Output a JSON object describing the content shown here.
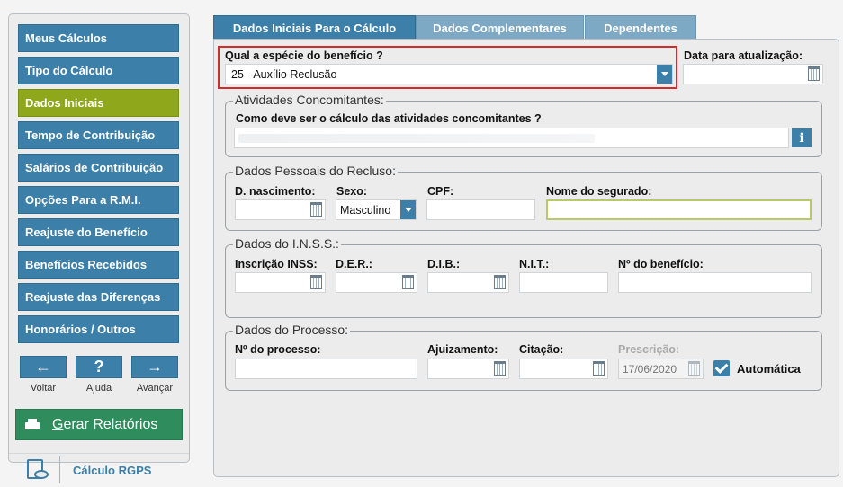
{
  "sidebar": {
    "items": [
      {
        "label": "Meus Cálculos"
      },
      {
        "label": "Tipo do Cálculo"
      },
      {
        "label": "Dados Iniciais"
      },
      {
        "label": "Tempo de Contribuição"
      },
      {
        "label": "Salários de Contribuição"
      },
      {
        "label": "Opções Para a R.M.I."
      },
      {
        "label": "Reajuste do Benefício"
      },
      {
        "label": "Benefícios Recebidos"
      },
      {
        "label": "Reajuste das Diferenças"
      },
      {
        "label": "Honorários / Outros"
      }
    ],
    "active_index": 2,
    "nav": {
      "back": {
        "glyph": "←",
        "label": "Voltar"
      },
      "help": {
        "glyph": "?",
        "label": "Ajuda"
      },
      "forward": {
        "glyph": "→",
        "label": "Avançar"
      }
    },
    "report_button": "Gerar Relatórios",
    "brand": "Cálculo RGPS"
  },
  "tabs": [
    {
      "label": "Dados Iniciais Para o Cálculo",
      "active": true
    },
    {
      "label": "Dados Complementares",
      "active": false
    },
    {
      "label": "Dependentes",
      "active": false
    }
  ],
  "form": {
    "especie_label": "Qual a espécie do benefício ?",
    "especie_value": "25 - Auxílio Reclusão",
    "data_atualizacao_label": "Data para atualização:",
    "atividades": {
      "legend": "Atividades Concomitantes:",
      "question": "Como deve ser o cálculo das atividades concomitantes ?",
      "info": "i"
    },
    "pessoais": {
      "legend": "Dados Pessoais do Recluso:",
      "nascimento": "D. nascimento:",
      "sexo": "Sexo:",
      "sexo_value": "Masculino",
      "cpf": "CPF:",
      "nome": "Nome do segurado:"
    },
    "inss": {
      "legend": "Dados do I.N.S.S.:",
      "inscricao": "Inscrição INSS:",
      "der": "D.E.R.:",
      "dib": "D.I.B.:",
      "nit": "N.I.T.:",
      "beneficio": "Nº do benefício:"
    },
    "processo": {
      "legend": "Dados do Processo:",
      "numero": "Nº do processo:",
      "ajuizamento": "Ajuizamento:",
      "citacao": "Citação:",
      "prescricao": "Prescrição:",
      "prescricao_value": "17/06/2020",
      "automatica": "Automática"
    }
  }
}
